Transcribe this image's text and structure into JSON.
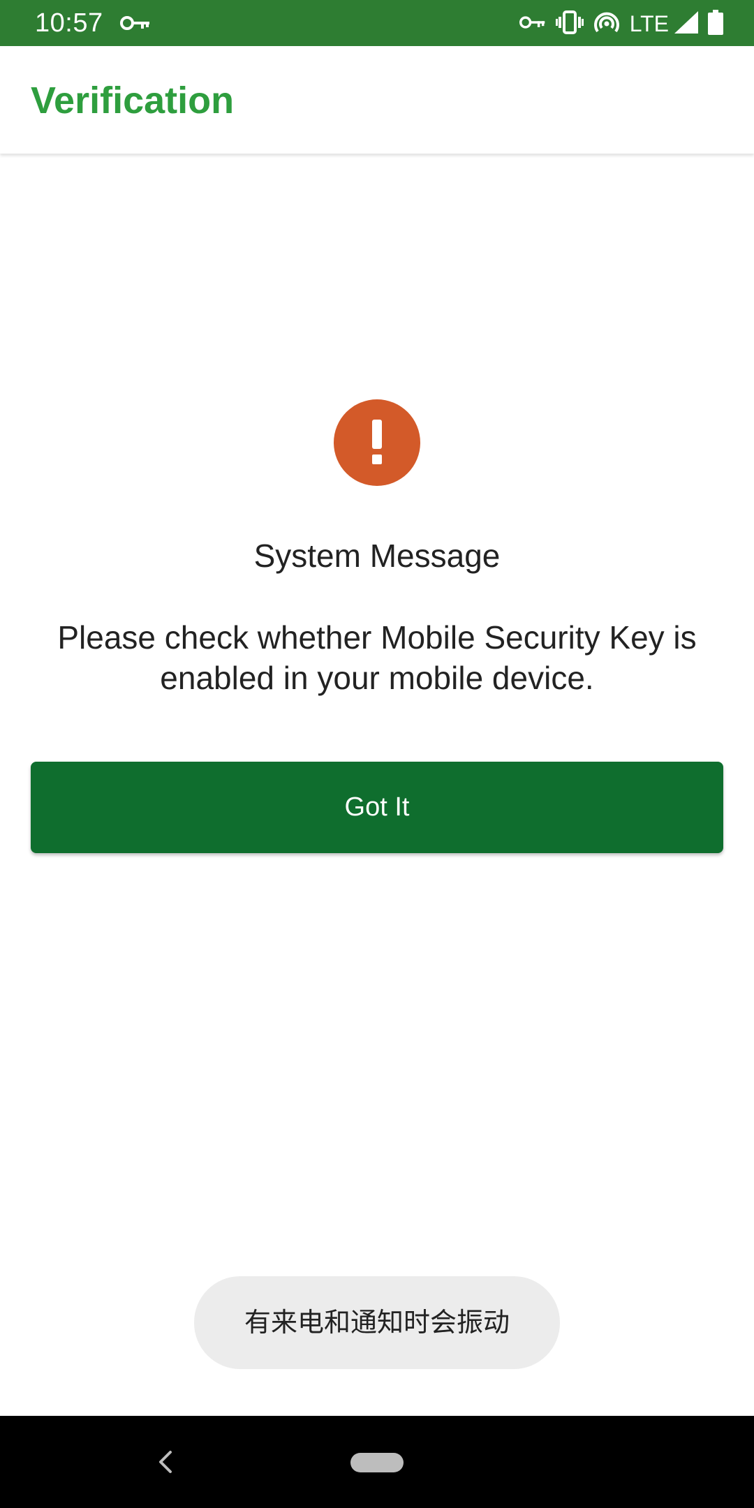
{
  "status_bar": {
    "time": "10:57",
    "network": "LTE",
    "icons": [
      "vpn-key-icon",
      "vpn-key-icon",
      "vibrate-icon",
      "hotspot-icon",
      "signal-icon",
      "battery-icon"
    ],
    "bg_color": "#2e7d32"
  },
  "app_bar": {
    "title": "Verification",
    "title_color": "#2e9e3e"
  },
  "dialog": {
    "icon": "alert-icon",
    "icon_color": "#d35a29",
    "title": "System Message",
    "message": "Please check whether Mobile Security Key is enabled in your mobile device.",
    "button_label": "Got It",
    "button_color": "#0f6e2e"
  },
  "toast": {
    "text": "有来电和通知时会振动"
  },
  "nav_bar": {
    "icons": [
      "back-icon",
      "home-pill-icon"
    ]
  }
}
